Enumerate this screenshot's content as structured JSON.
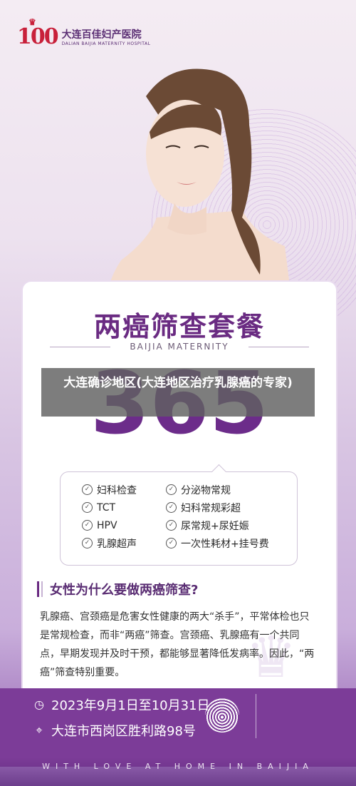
{
  "logo": {
    "number": "100",
    "name_cn": "大连百佳妇产医院",
    "name_en": "DALIAN BAIJIA MATERNITY HOSPITAL"
  },
  "card": {
    "title": "两癌筛查套餐",
    "subtitle": "BAIJIA MATERNITY",
    "price": "365"
  },
  "overlay": {
    "title": "大连确诊地区(大连地区治疗乳腺癌的专家)"
  },
  "checklist": [
    {
      "label": "妇科检查"
    },
    {
      "label": "分泌物常规"
    },
    {
      "label": "TCT"
    },
    {
      "label": "妇科常规彩超"
    },
    {
      "label": "HPV"
    },
    {
      "label": "尿常规+尿妊娠"
    },
    {
      "label": "乳腺超声"
    },
    {
      "label": "一次性耗材+挂号费"
    }
  ],
  "question": "女性为什么要做两癌筛查?",
  "paragraph": "乳腺癌、宫颈癌是危害女性健康的两大“杀手”，平常体检也只是常规检查，而非“两癌”筛查。宫颈癌、乳腺癌有一个共同点，早期发现并及时干预，都能够显著降低发病率。因此，“两癌”筛查特别重要。",
  "info": {
    "date": "2023年9月1日至10月31日",
    "address": "大连市西岗区胜利路98号"
  },
  "footer": "WITH LOVE AT HOME IN BAIJIA",
  "icons": {
    "clock": "clock-icon",
    "location": "location-pin-icon",
    "check": "check-circle-icon",
    "fingerprint": "fingerprint-icon"
  },
  "colors": {
    "brand_purple": "#6a2b82",
    "logo_red": "#c8203a",
    "info_bar": "#7c3c98"
  }
}
